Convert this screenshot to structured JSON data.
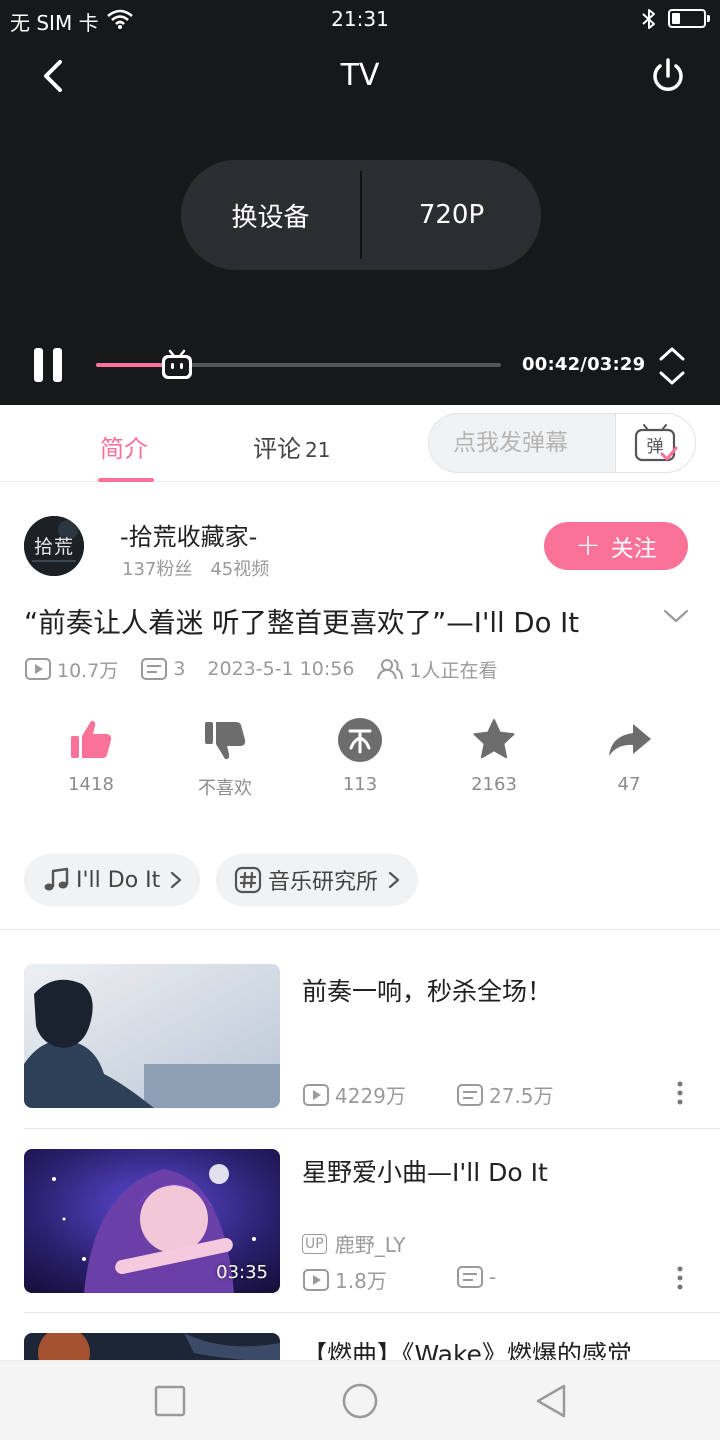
{
  "status_bar": {
    "carrier": "无 SIM 卡",
    "time": "21:31",
    "battery_level": 0.35
  },
  "player": {
    "title": "TV",
    "cast_controls": {
      "switch_device_label": "换设备",
      "quality_label": "720P"
    },
    "progress_fraction": 0.2,
    "time_readout": "00:42/03:29"
  },
  "tabs": {
    "intro_label": "简介",
    "comments_label": "评论",
    "comments_count": "21",
    "danmaku_placeholder": "点我发弹幕",
    "danmaku_icon_char": "弹"
  },
  "uploader": {
    "avatar_text": "拾荒",
    "name": "-拾荒收藏家-",
    "fans": "137粉丝",
    "videos": "45视频",
    "follow_label": "关注"
  },
  "video": {
    "title": "“前奏让人着迷 听了整首更喜欢了”—I'll Do It",
    "views": "10.7万",
    "danmaku_count": "3",
    "publish_time": "2023-5-1 10:56",
    "watching": "1人正在看"
  },
  "actions": {
    "like": "1418",
    "dislike": "不喜欢",
    "coin": "113",
    "favorite": "2163",
    "share": "47"
  },
  "tags": {
    "song": "I'll Do It",
    "topic": "音乐研究所"
  },
  "related": [
    {
      "title": "前奏一响，秒杀全场！",
      "views": "4229万",
      "danmaku": "27.5万"
    },
    {
      "title": "星野爱小曲—I'll Do It",
      "up_badge": "UP",
      "uploader": "鹿野_LY",
      "views": "1.8万",
      "danmaku": "-",
      "duration": "03:35"
    },
    {
      "title": "【燃曲】《Wake》燃爆的感觉"
    }
  ],
  "colors": {
    "accent": "#fb7299",
    "player_bg": "#17181a",
    "muted_text": "#9a9a9a"
  },
  "icons": {
    "back": "chevron-left-icon",
    "power": "power-icon",
    "pause": "pause-icon",
    "fullscreen": "expand-vertical-icon",
    "like": "thumbs-up-icon",
    "dislike": "thumbs-down-icon",
    "coin": "coin-icon",
    "favorite": "star-icon",
    "share": "share-arrow-icon"
  }
}
